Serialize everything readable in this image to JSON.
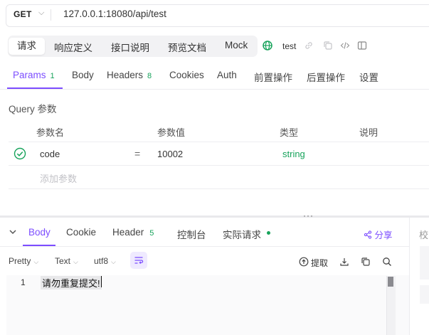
{
  "request": {
    "method": "GET",
    "url": "127.0.0.1:18080/api/test"
  },
  "top_tabs": [
    "请求",
    "响应定义",
    "接口说明",
    "预览文档",
    "Mock"
  ],
  "environment": {
    "name": "test"
  },
  "param_tabs": [
    {
      "label": "Params",
      "count": "1"
    },
    {
      "label": "Body",
      "count": ""
    },
    {
      "label": "Headers",
      "count": "8"
    },
    {
      "label": "Cookies",
      "count": ""
    },
    {
      "label": "Auth",
      "count": ""
    },
    {
      "label": "前置操作",
      "count": ""
    },
    {
      "label": "后置操作",
      "count": ""
    },
    {
      "label": "设置",
      "count": ""
    }
  ],
  "query": {
    "section_label": "Query 参数",
    "columns": [
      "参数名",
      "参数值",
      "类型",
      "说明"
    ],
    "rows": [
      {
        "name": "code",
        "operator": "=",
        "value": "10002",
        "type": "string",
        "description": ""
      }
    ],
    "add_placeholder": "添加参数"
  },
  "response": {
    "tabs": [
      {
        "label": "Body",
        "count": ""
      },
      {
        "label": "Cookie",
        "count": ""
      },
      {
        "label": "Header",
        "count": "5"
      },
      {
        "label": "控制台",
        "count": ""
      },
      {
        "label": "实际请求",
        "count": ""
      }
    ],
    "share_label": "分享",
    "side_panel_label": "校",
    "toolbar": {
      "format": "Pretty",
      "view": "Text",
      "encoding": "utf8",
      "extract_label": "提取"
    },
    "body_lines": [
      {
        "number": "1",
        "text": "请勿重复提交!"
      }
    ]
  },
  "colors": {
    "accent": "#7c4dff",
    "success": "#17a35b"
  }
}
